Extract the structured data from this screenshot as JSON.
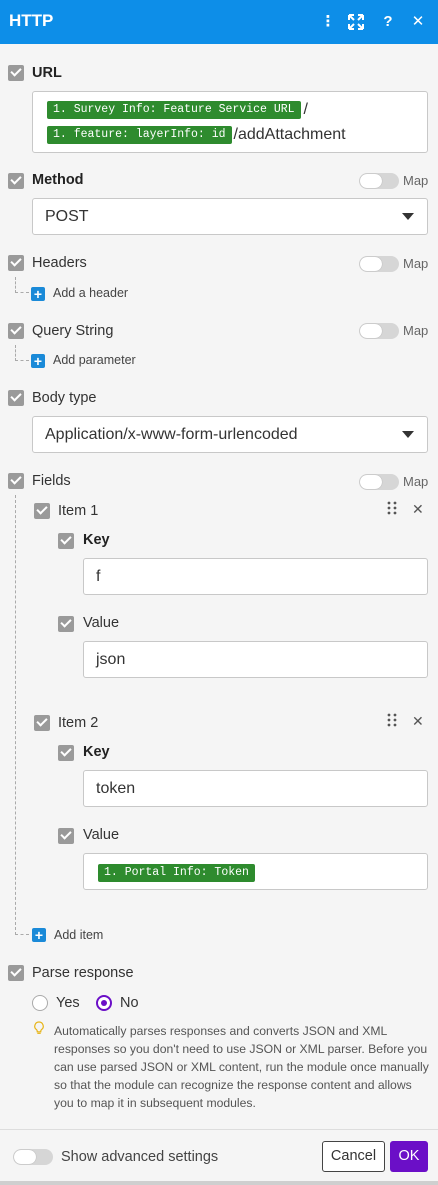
{
  "header": {
    "title": "HTTP",
    "icons": [
      "more-vertical-icon",
      "expand-icon",
      "help-icon",
      "close-icon"
    ],
    "more_glyph": "⋮",
    "expand_glyph": "⛶",
    "help_glyph": "?",
    "close_glyph": "✕"
  },
  "url": {
    "label": "URL",
    "token1": "1. Survey Info: Feature Service URL",
    "sep": "/",
    "token2": "1. feature: layerInfo: id",
    "suffix": "/addAttachment"
  },
  "method": {
    "label": "Method",
    "map_label": "Map",
    "value": "POST"
  },
  "headers": {
    "label": "Headers",
    "map_label": "Map",
    "add_label": "Add a header"
  },
  "query_string": {
    "label": "Query String",
    "map_label": "Map",
    "add_label": "Add parameter"
  },
  "body_type": {
    "label": "Body type",
    "value": "Application/x-www-form-urlencoded"
  },
  "fields": {
    "label": "Fields",
    "map_label": "Map",
    "items": [
      {
        "title": "Item 1",
        "key_label": "Key",
        "key_value": "f",
        "value_label": "Value",
        "value_value": "json"
      },
      {
        "title": "Item 2",
        "key_label": "Key",
        "key_value": "token",
        "value_label": "Value",
        "value_token": "1. Portal Info: Token"
      }
    ],
    "add_label": "Add item"
  },
  "parse_response": {
    "label": "Parse response",
    "yes": "Yes",
    "no": "No",
    "selected": "No",
    "hint": "Automatically parses responses and converts JSON and XML responses so you don't need to use JSON or XML parser. Before you can use parsed JSON or XML content, run the module once manually so that the module can recognize the response content and allows you to map it in subsequent modules."
  },
  "footer": {
    "advanced_label": "Show advanced settings",
    "cancel": "Cancel",
    "ok": "OK"
  },
  "colors": {
    "header_bg": "#0d8ee8",
    "token_bg": "#2e8b2e",
    "accent_purple": "#6b0fc7",
    "add_blue": "#1a8ad8"
  }
}
